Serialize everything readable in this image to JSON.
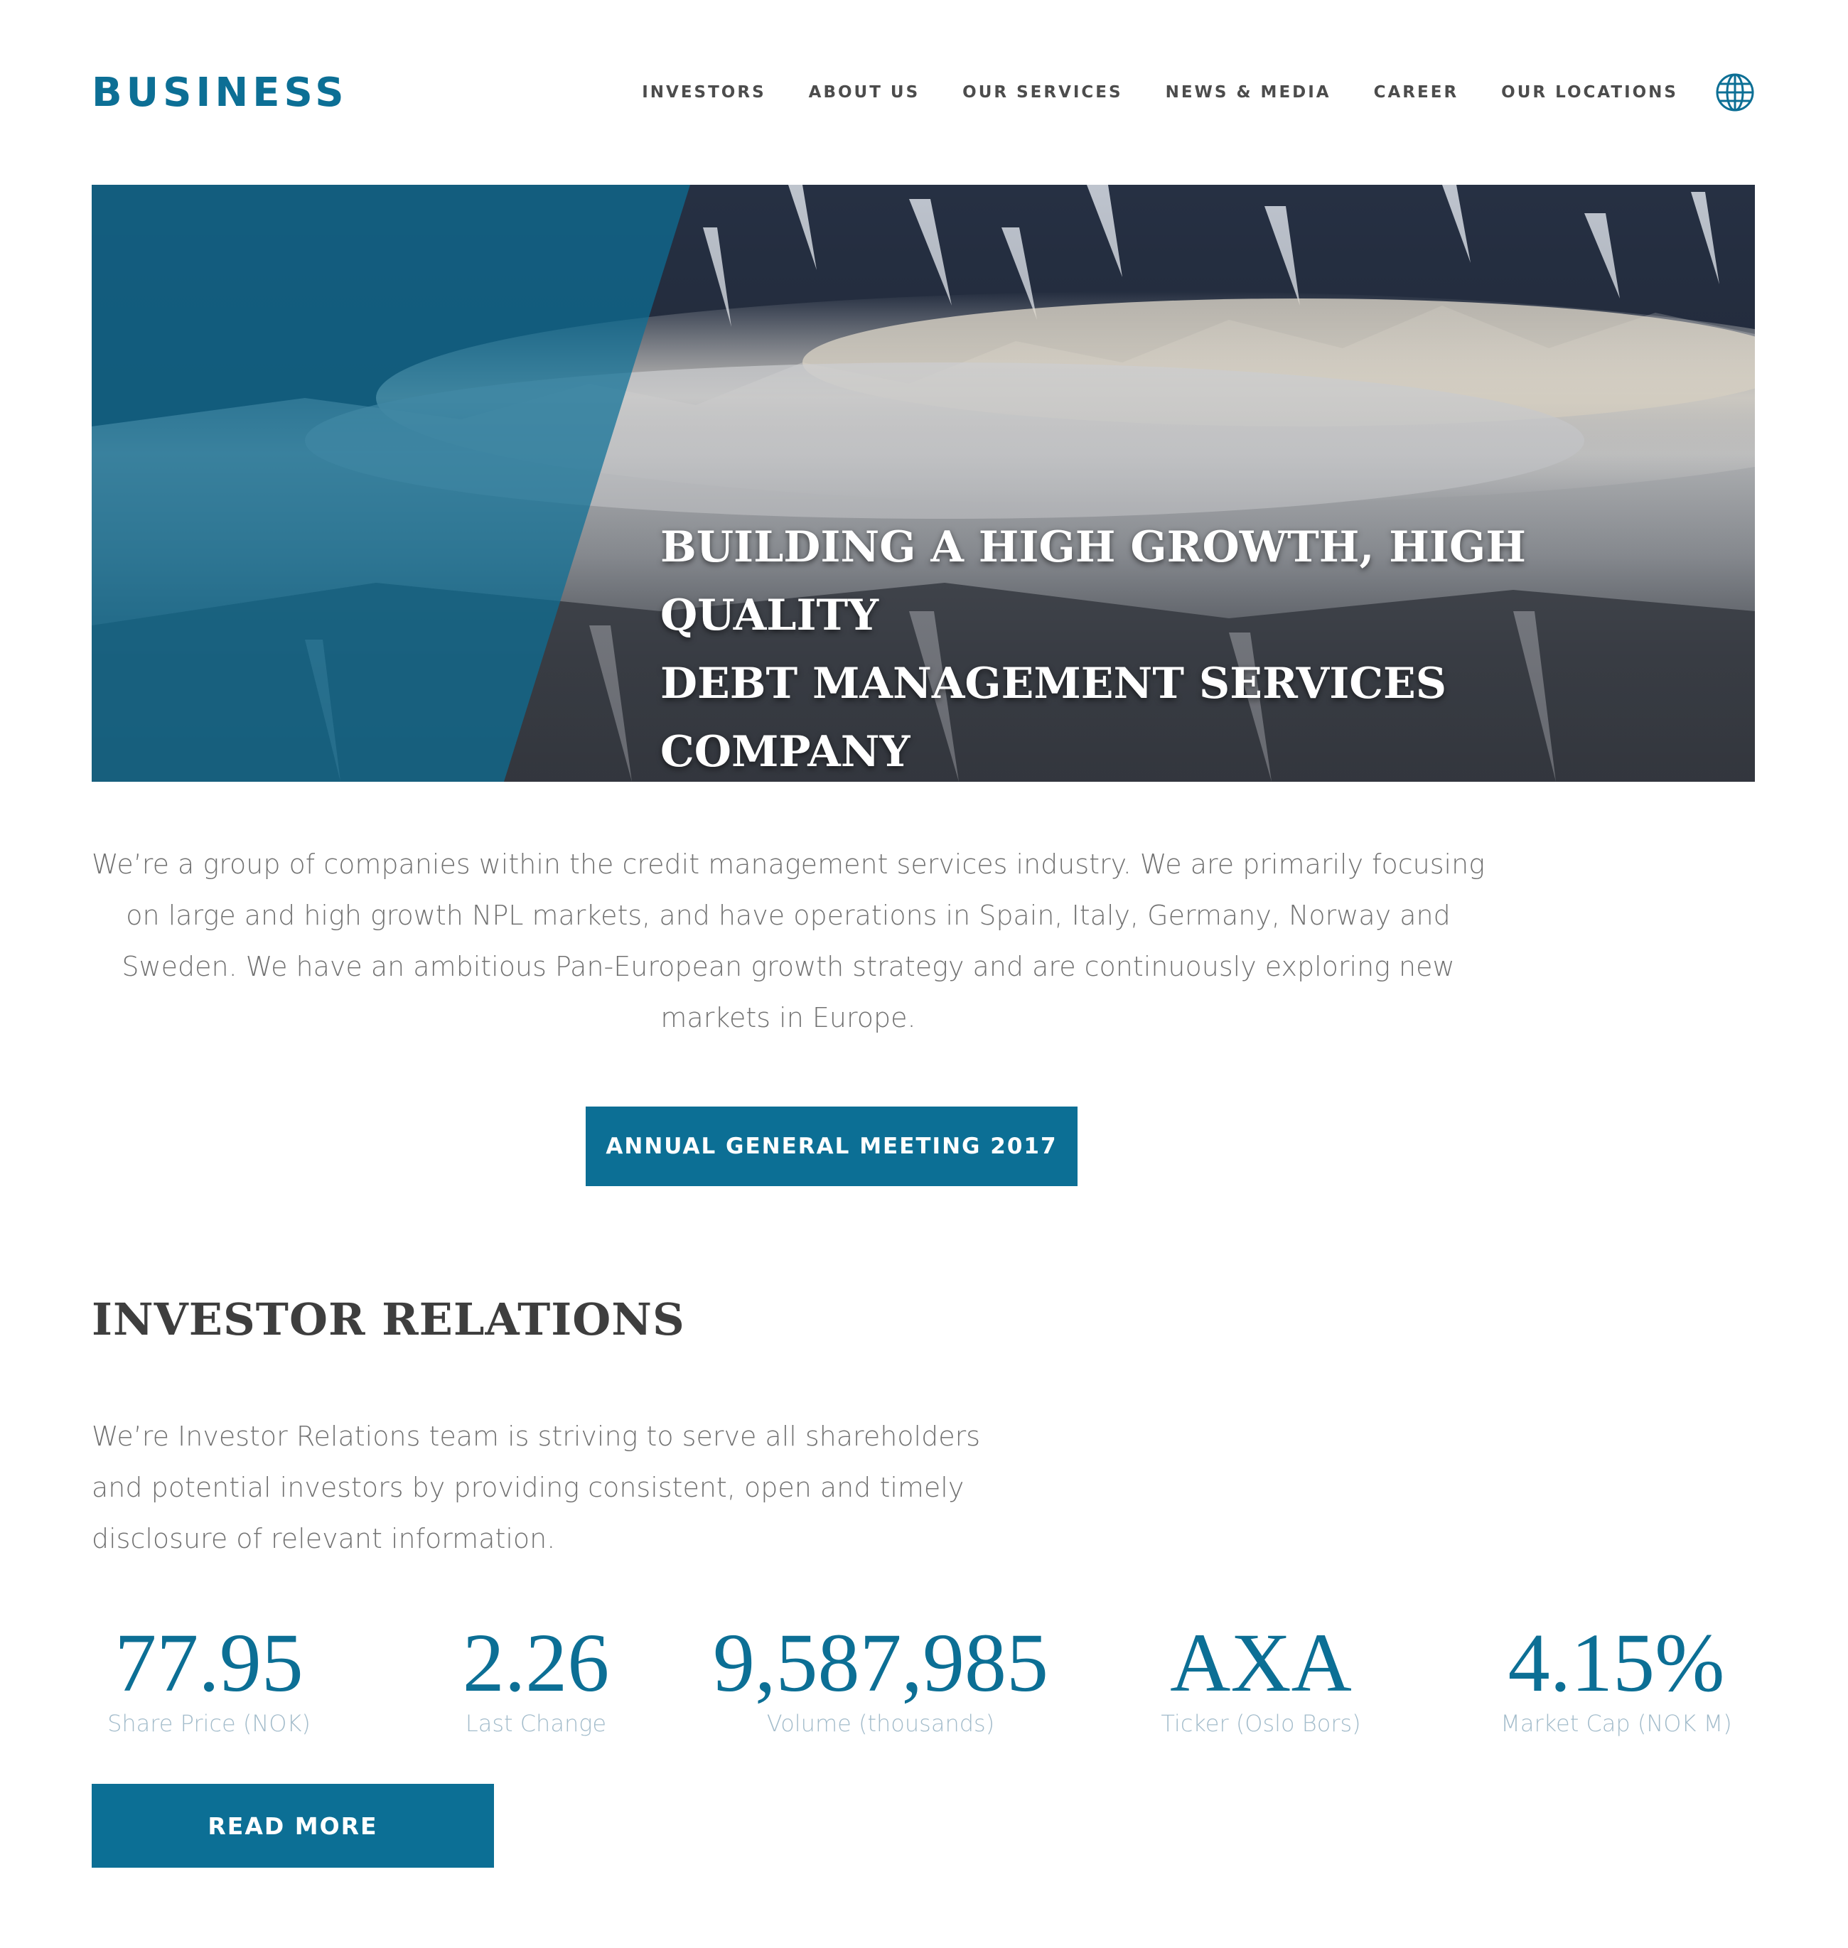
{
  "brand": {
    "logo_text": "BUSINESS",
    "accent_color": "#0c6f95"
  },
  "nav": {
    "items": [
      {
        "label": "INVESTORS"
      },
      {
        "label": "ABOUT US"
      },
      {
        "label": "OUR SERVICES"
      },
      {
        "label": "NEWS & MEDIA"
      },
      {
        "label": "CAREER"
      },
      {
        "label": "OUR LOCATIONS"
      }
    ],
    "language_icon": "globe-icon"
  },
  "hero": {
    "title_line1": "BUILDING A HIGH GROWTH, HIGH QUALITY",
    "title_line2": "DEBT MANAGEMENT SERVICES COMPANY"
  },
  "intro": {
    "text": "We’re a group of companies within the credit management services industry. We are primarily focusing on large and high growth NPL markets, and have operations in Spain, Italy, Germany, Norway and Sweden. We have an ambitious Pan-European growth strategy and are continuously exploring new markets in Europe.",
    "button_label": "ANNUAL GENERAL MEETING 2017"
  },
  "investor_relations": {
    "title": "INVESTOR RELATIONS",
    "text": "We’re Investor Relations team is striving to serve all shareholders and potential investors by providing consistent, open and timely disclosure of relevant information.",
    "stats": [
      {
        "value": "77.95",
        "label": "Share Price (NOK)"
      },
      {
        "value": "2.26",
        "label": "Last Change"
      },
      {
        "value": "9,587,985",
        "label": "Volume (thousands)"
      },
      {
        "value": "AXA",
        "label": "Ticker (Oslo Bors)"
      },
      {
        "value": "4.15%",
        "label": "Market Cap (NOK M)"
      }
    ],
    "button_label": "READ MORE"
  }
}
